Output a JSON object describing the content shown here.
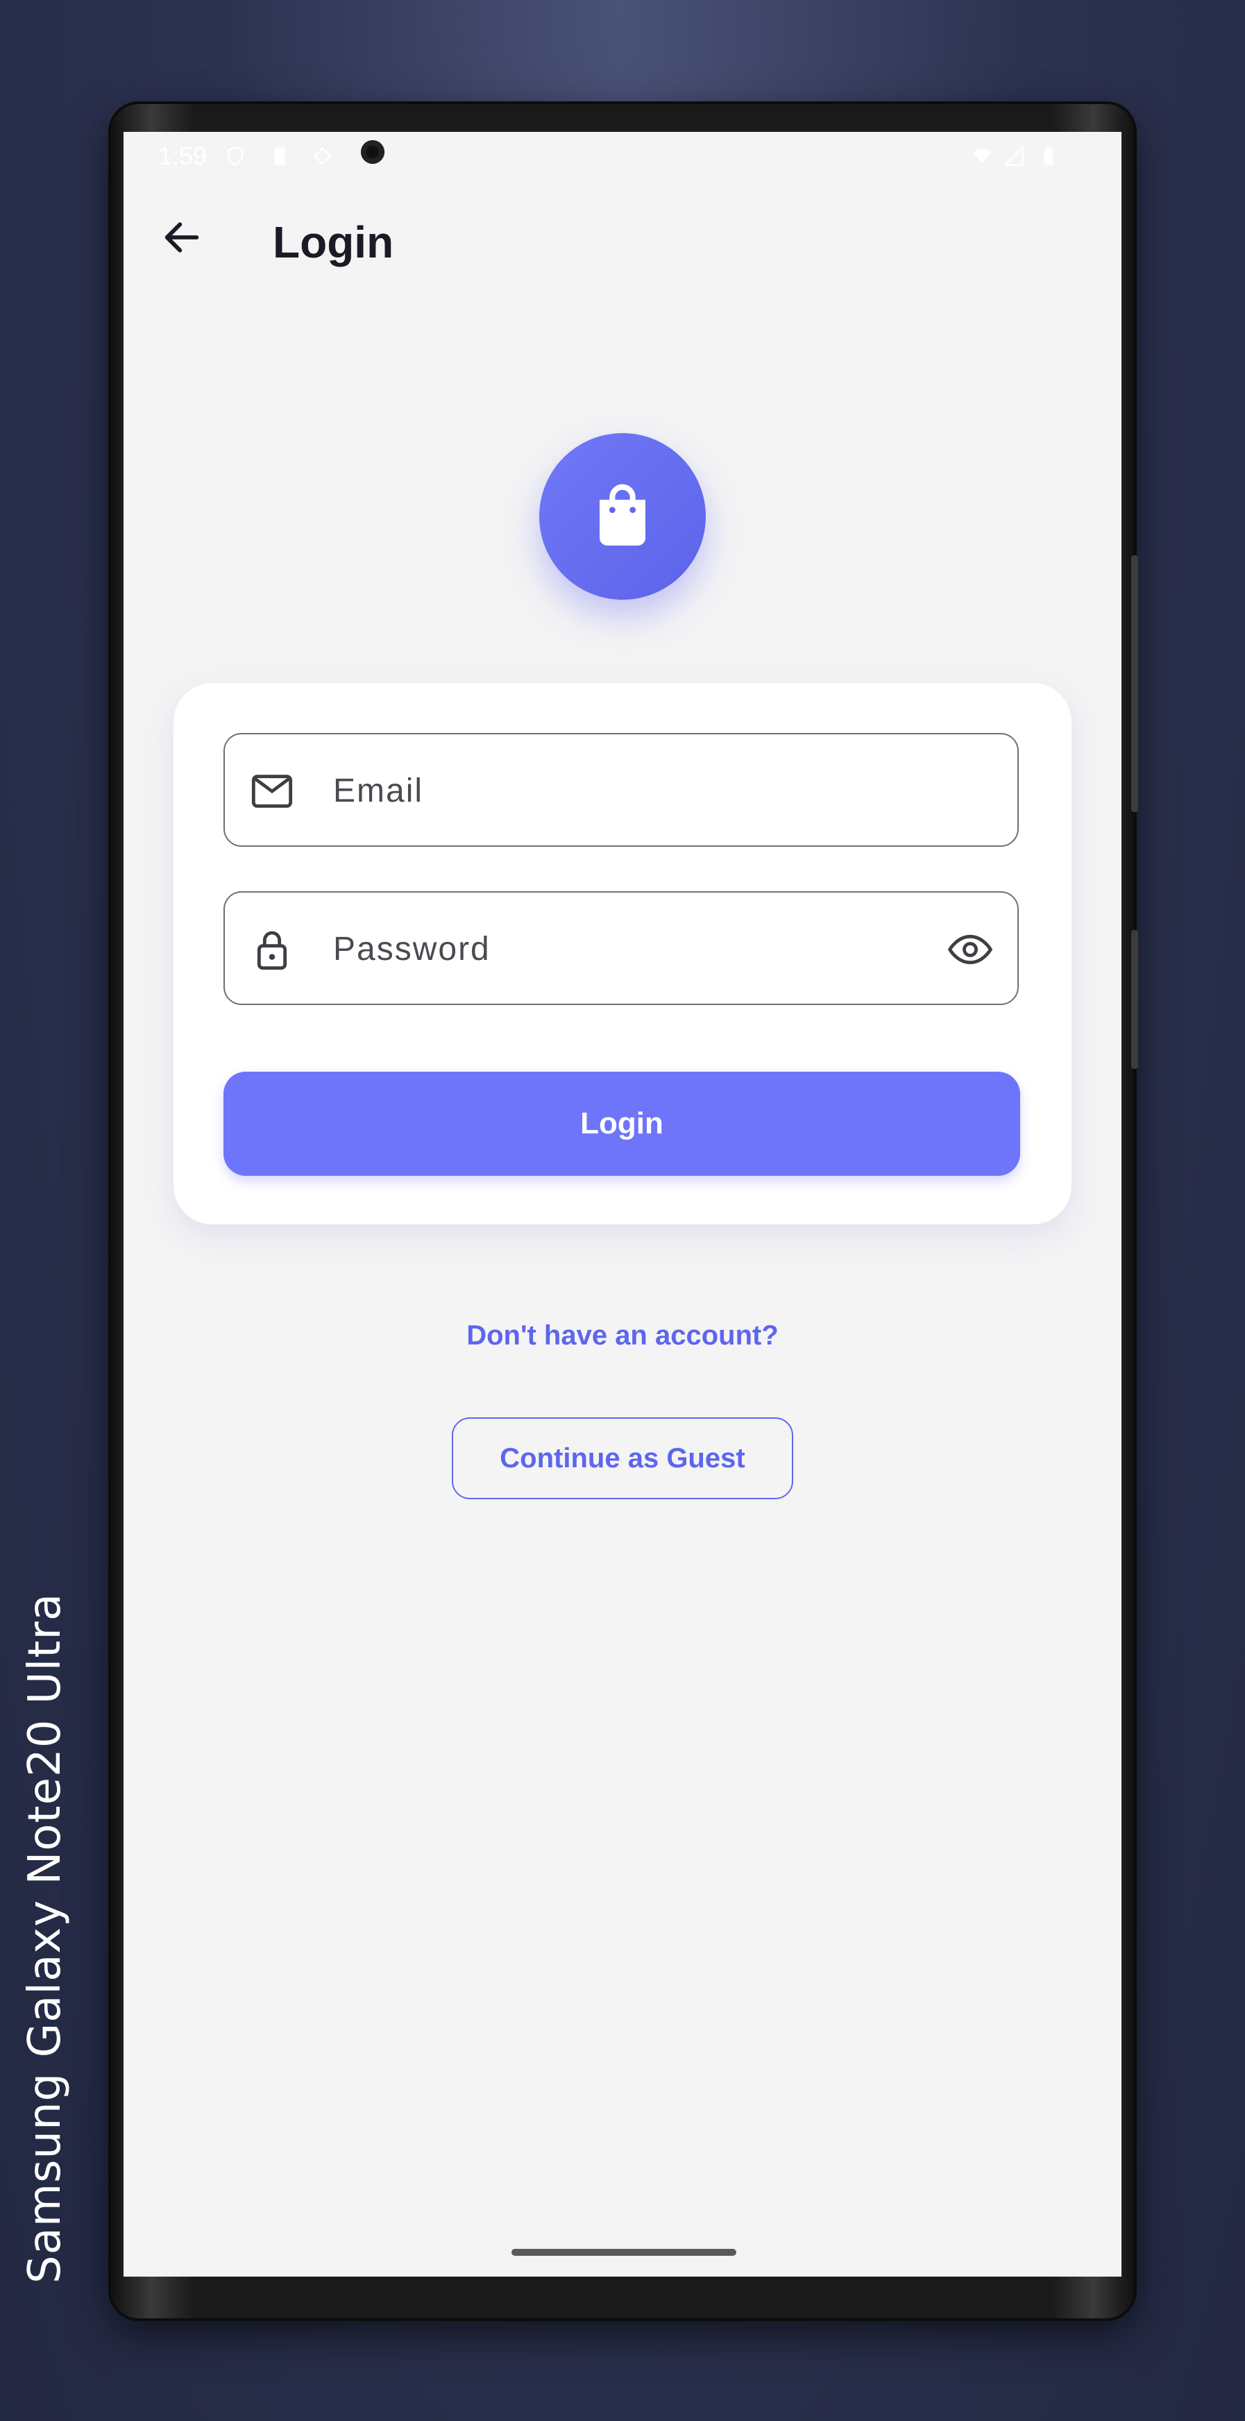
{
  "device": {
    "label": "Samsung Galaxy  Note20 Ultra"
  },
  "status_bar": {
    "time": "1:59"
  },
  "app_bar": {
    "title": "Login"
  },
  "form": {
    "email": {
      "placeholder": "Email",
      "value": ""
    },
    "password": {
      "placeholder": "Password",
      "value": ""
    },
    "login_label": "Login"
  },
  "links": {
    "signup": "Don't have an account?",
    "guest": "Continue as Guest"
  },
  "theme": {
    "accent": "#6e75fa",
    "background": "#f4f4f5",
    "text": "#1a1b24"
  },
  "icons": {
    "back": "arrow-left",
    "logo": "shopping-bag",
    "email": "mail-outline",
    "password": "lock-outline",
    "visibility": "eye-outline"
  }
}
